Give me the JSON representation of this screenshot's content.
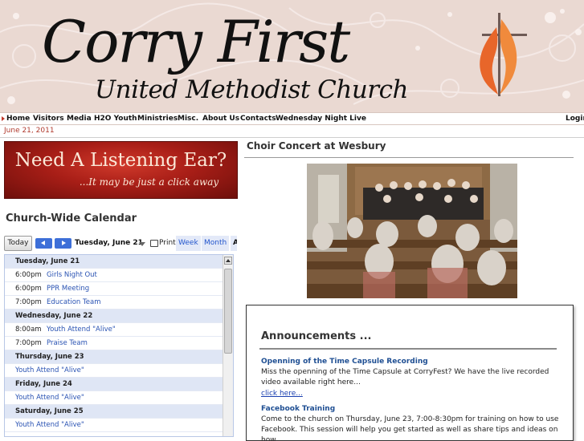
{
  "header": {
    "logo_line1": "Corry First",
    "logo_line2": "United Methodist Church",
    "colors": {
      "background": "#ead9d2",
      "accent": "#e8662a"
    }
  },
  "nav": {
    "items": [
      "Home",
      "Visitors",
      "Media",
      "H2O Youth",
      "Ministries",
      "Misc.",
      "About Us",
      "Contacts",
      "Wednesday Night Live"
    ],
    "login": "Login"
  },
  "date": "June 21, 2011",
  "banner": {
    "line1": "Need A Listening Ear?",
    "line2": "...It may be just a click away"
  },
  "calendar": {
    "title": "Church-Wide Calendar",
    "today_label": "Today",
    "current_date": "Tuesday, June 21",
    "print_label": "Print",
    "week_label": "Week",
    "month_label": "Month",
    "agenda_label": "A",
    "rows": [
      {
        "type": "day",
        "label": "Tuesday, June 21"
      },
      {
        "type": "event",
        "time": "6:00pm",
        "title": "Girls Night Out"
      },
      {
        "type": "event",
        "time": "6:00pm",
        "title": "PPR Meeting"
      },
      {
        "type": "event",
        "time": "7:00pm",
        "title": "Education Team"
      },
      {
        "type": "day",
        "label": "Wednesday, June 22"
      },
      {
        "type": "event",
        "time": "8:00am",
        "title": "Youth Attend \"Alive\""
      },
      {
        "type": "event",
        "time": "7:00pm",
        "title": "Praise Team"
      },
      {
        "type": "day",
        "label": "Thursday, June 23"
      },
      {
        "type": "allday",
        "title": "Youth Attend \"Alive\""
      },
      {
        "type": "day",
        "label": "Friday, June 24"
      },
      {
        "type": "allday",
        "title": "Youth Attend \"Alive\""
      },
      {
        "type": "day",
        "label": "Saturday, June 25"
      },
      {
        "type": "allday",
        "title": "Youth Attend \"Alive\""
      }
    ]
  },
  "post": {
    "title": "Choir Concert at Wesbury"
  },
  "announcements": {
    "title": "Announcements ...",
    "items": [
      {
        "title": "Openning of the Time Capsule Recording",
        "text": "Miss the openning of the Time Capsule at CorryFest? We have the live recorded video available right here...",
        "link": "click here..."
      },
      {
        "title": "Facebook Training",
        "text": "Come to the church on Thursday, June 23, 7:00-8:30pm for training on how to use Facebook. This session will help you get started as well as share tips and ideas on how"
      }
    ]
  }
}
